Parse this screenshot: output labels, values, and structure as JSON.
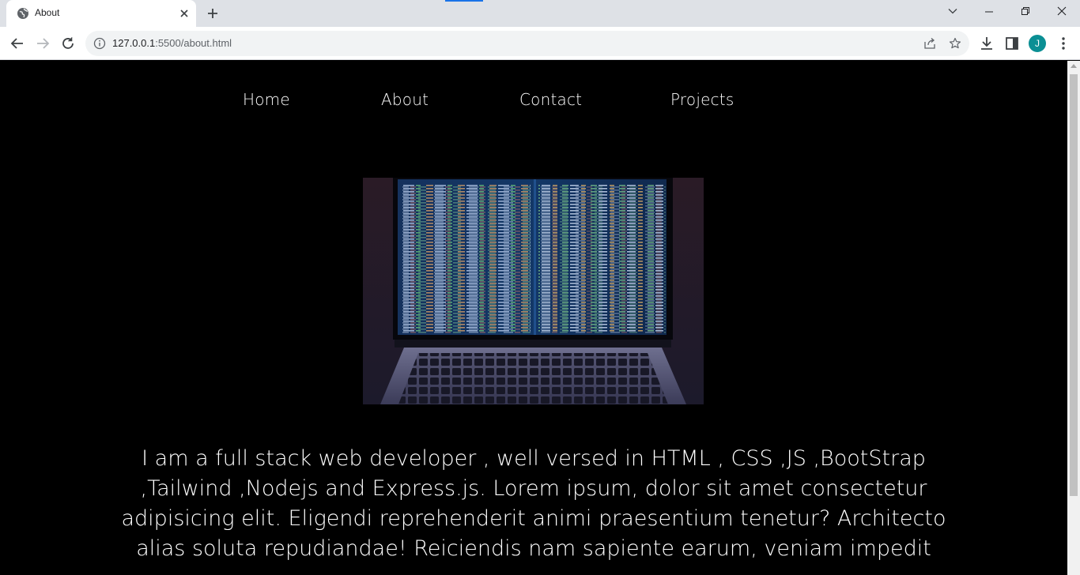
{
  "browser": {
    "tab_title": "About",
    "url_host": "127.0.0.1",
    "url_path": ":5500/about.html",
    "profile_initial": "J",
    "profile_color": "#0b8f94"
  },
  "site": {
    "nav": [
      "Home",
      "About",
      "Contact",
      "Projects"
    ],
    "hero_image": "laptop-code-photo",
    "about_text": "I am a full stack web developer , well versed in HTML , CSS ,JS ,BootStrap ,Tailwind ,Nodejs and Express.js. Lorem ipsum, dolor sit amet consectetur adipisicing elit. Eligendi reprehenderit animi praesentium tenetur? Architecto alias soluta repudiandae! Reiciendis nam sapiente earum, veniam impedit"
  }
}
